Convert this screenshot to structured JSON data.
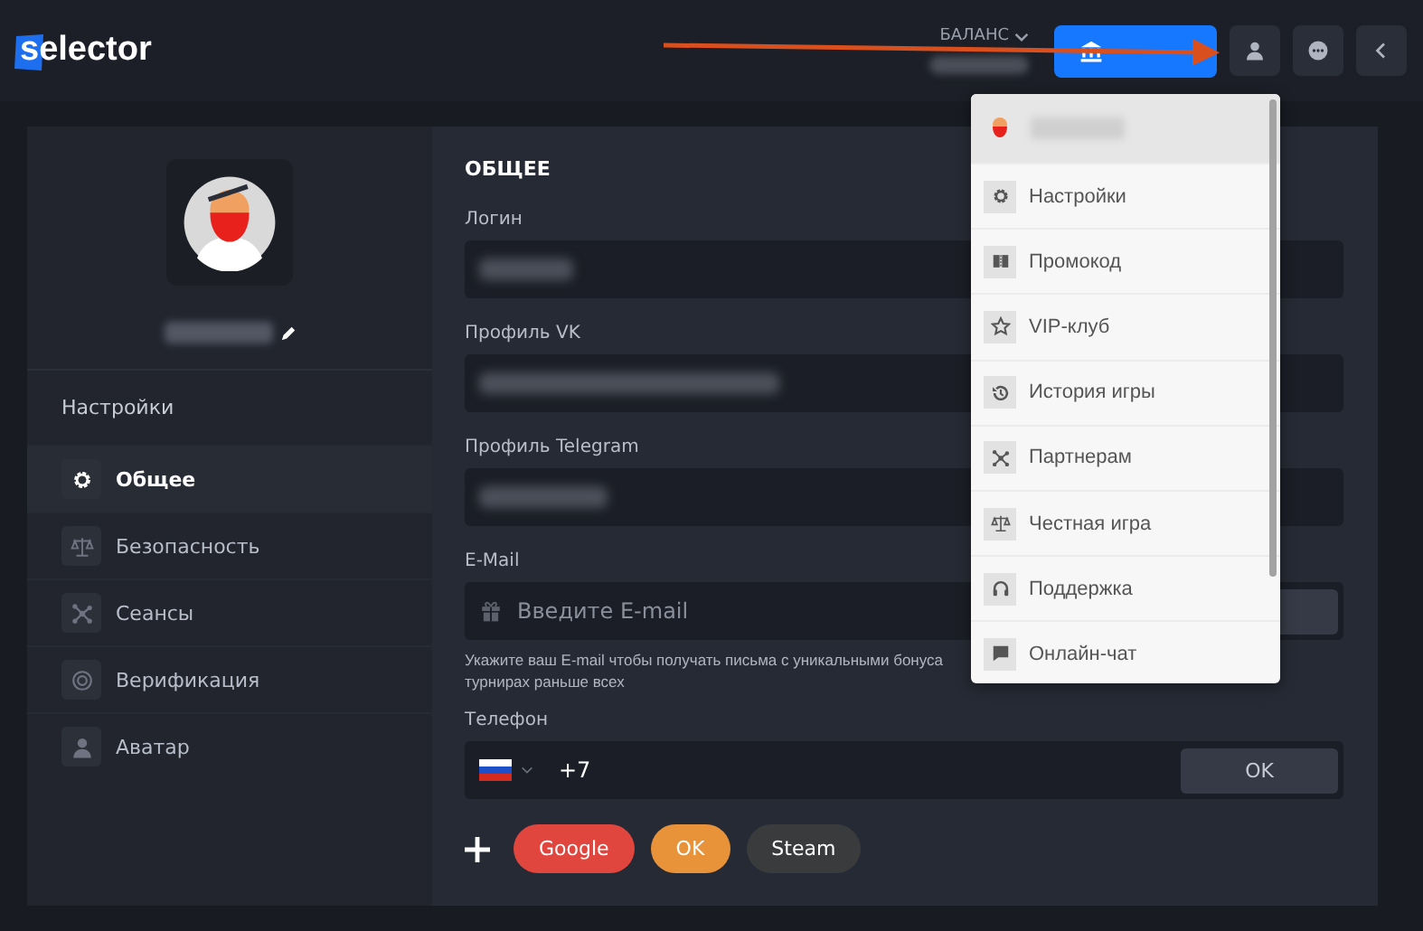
{
  "header": {
    "logo": "selector",
    "balance_label": "БАЛАНС"
  },
  "sidebar": {
    "heading": "Настройки",
    "items": [
      {
        "label": "Общее",
        "selected": true
      },
      {
        "label": "Безопасность",
        "selected": false
      },
      {
        "label": "Сеансы",
        "selected": false
      },
      {
        "label": "Верификация",
        "selected": false
      },
      {
        "label": "Аватар",
        "selected": false
      }
    ]
  },
  "content": {
    "title": "ОБЩЕЕ",
    "fields": [
      {
        "kind": "blurred",
        "label": "Логин"
      },
      {
        "kind": "blurred",
        "label": "Профиль VK"
      },
      {
        "kind": "blurred",
        "label": "Профиль Telegram"
      },
      {
        "kind": "email",
        "label": "E-Mail",
        "placeholder": "Введите E-mail",
        "hint_lines": [
          "Укажите ваш E-mail чтобы получать письма с уникальными бонуса",
          "турнирах раньше всех"
        ]
      },
      {
        "kind": "phone",
        "label": "Телефон",
        "value": "+7",
        "button": "OK"
      }
    ],
    "socials": [
      {
        "label": "Google",
        "color": "#e0463d"
      },
      {
        "label": "OK",
        "color": "#e8923a"
      },
      {
        "label": "Steam",
        "color": "#3a3b3d"
      }
    ]
  },
  "dropdown": {
    "items": [
      "Настройки",
      "Промокод",
      "VIP-клуб",
      "История игры",
      "Партнерам",
      "Честная игра",
      "Поддержка",
      "Онлайн-чат"
    ]
  }
}
